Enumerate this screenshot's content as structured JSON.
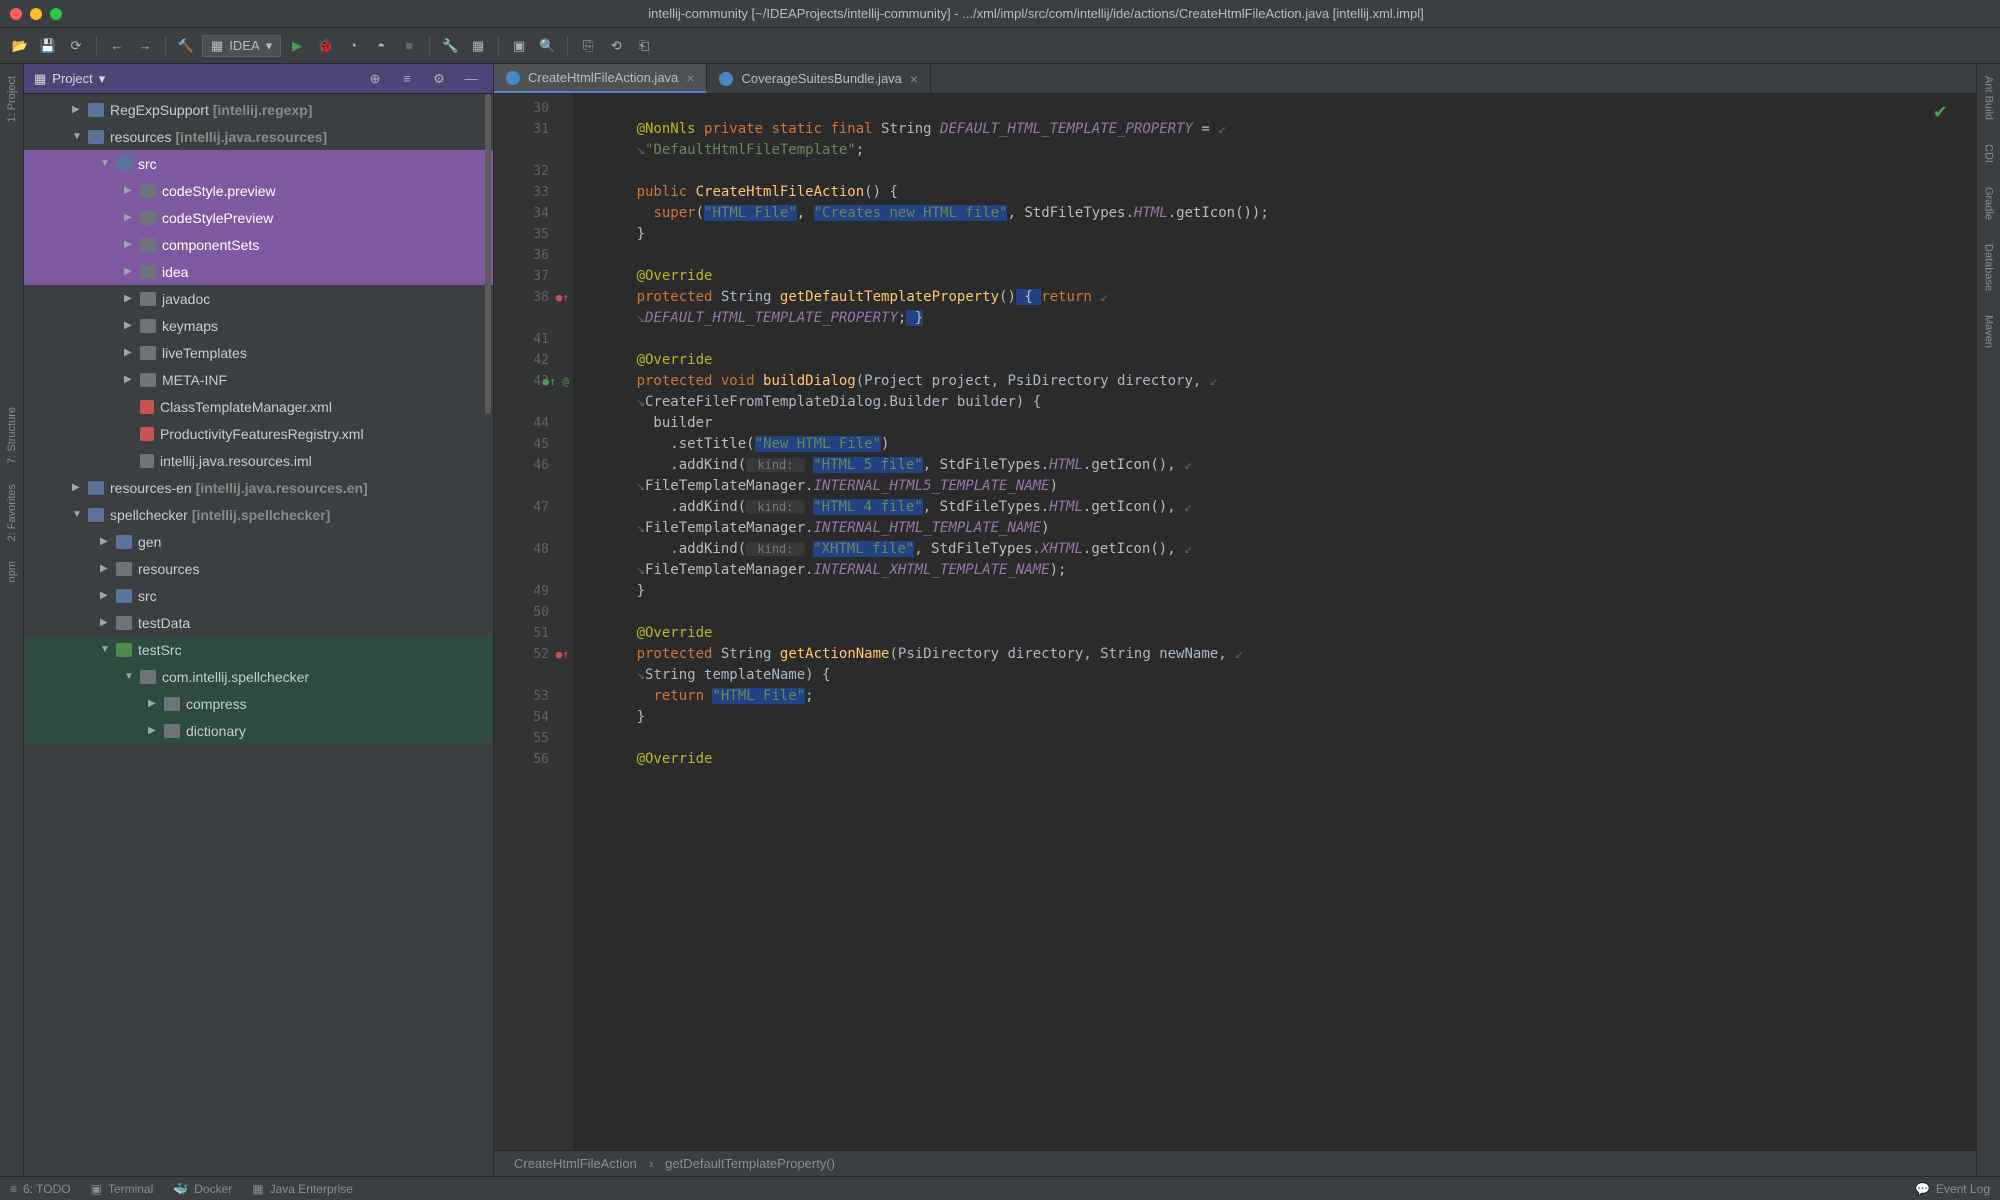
{
  "title": "intellij-community [~/IDEAProjects/intellij-community] - .../xml/impl/src/com/intellij/ide/actions/CreateHtmlFileAction.java [intellij.xml.impl]",
  "runConfig": "IDEA",
  "panel": {
    "title": "Project"
  },
  "tree": [
    {
      "lvl": 1,
      "arrow": "right",
      "icon": "folder-blue",
      "label": "RegExpSupport",
      "extra": "[intellij.regexp]"
    },
    {
      "lvl": 1,
      "arrow": "down",
      "icon": "folder-blue",
      "label": "resources",
      "extra": "[intellij.java.resources]"
    },
    {
      "lvl": 2,
      "arrow": "down",
      "icon": "folder-blue",
      "label": "src",
      "sel": "purple"
    },
    {
      "lvl": 3,
      "arrow": "right",
      "icon": "folder-grey",
      "label": "codeStyle.preview",
      "sel": "purple"
    },
    {
      "lvl": 3,
      "arrow": "right",
      "icon": "folder-grey",
      "label": "codeStylePreview",
      "sel": "purple"
    },
    {
      "lvl": 3,
      "arrow": "right",
      "icon": "folder-grey",
      "label": "componentSets",
      "sel": "purple"
    },
    {
      "lvl": 3,
      "arrow": "right",
      "icon": "folder-grey",
      "label": "idea",
      "sel": "purple"
    },
    {
      "lvl": 3,
      "arrow": "right",
      "icon": "folder-grey",
      "label": "javadoc"
    },
    {
      "lvl": 3,
      "arrow": "right",
      "icon": "folder-grey",
      "label": "keymaps"
    },
    {
      "lvl": 3,
      "arrow": "right",
      "icon": "folder-grey",
      "label": "liveTemplates"
    },
    {
      "lvl": 3,
      "arrow": "right",
      "icon": "folder-grey",
      "label": "META-INF"
    },
    {
      "lvl": 3,
      "arrow": "none",
      "icon": "file-xml",
      "label": "ClassTemplateManager.xml"
    },
    {
      "lvl": 3,
      "arrow": "none",
      "icon": "file-xml",
      "label": "ProductivityFeaturesRegistry.xml"
    },
    {
      "lvl": 3,
      "arrow": "none",
      "icon": "file-iml",
      "label": "intellij.java.resources.iml"
    },
    {
      "lvl": 1,
      "arrow": "right",
      "icon": "folder-blue",
      "label": "resources-en",
      "extra": "[intellij.java.resources.en]"
    },
    {
      "lvl": 1,
      "arrow": "down",
      "icon": "folder-blue",
      "label": "spellchecker",
      "extra": "[intellij.spellchecker]"
    },
    {
      "lvl": 2,
      "arrow": "right",
      "icon": "folder-blue",
      "label": "gen"
    },
    {
      "lvl": 2,
      "arrow": "right",
      "icon": "folder-grey",
      "label": "resources"
    },
    {
      "lvl": 2,
      "arrow": "right",
      "icon": "folder-blue",
      "label": "src"
    },
    {
      "lvl": 2,
      "arrow": "right",
      "icon": "folder-grey",
      "label": "testData"
    },
    {
      "lvl": 2,
      "arrow": "down",
      "icon": "folder-green",
      "label": "testSrc",
      "sel": "green"
    },
    {
      "lvl": 3,
      "arrow": "down",
      "icon": "folder-grey",
      "label": "com.intellij.spellchecker",
      "sel": "green"
    },
    {
      "lvl": 4,
      "arrow": "right",
      "icon": "folder-grey",
      "label": "compress",
      "sel": "green"
    },
    {
      "lvl": 4,
      "arrow": "right",
      "icon": "folder-grey",
      "label": "dictionary",
      "sel": "green"
    }
  ],
  "tabs": [
    {
      "label": "CreateHtmlFileAction.java",
      "active": true
    },
    {
      "label": "CoverageSuitesBundle.java",
      "active": false
    }
  ],
  "leftStrip": [
    "1: Project",
    "7: Structure",
    "2: Favorites",
    "npm"
  ],
  "rightStrip": [
    "Ant Build",
    "CDI",
    "Gradle",
    "Database",
    "Maven"
  ],
  "breadcrumb": [
    "CreateHtmlFileAction",
    "getDefaultTemplateProperty()"
  ],
  "status": [
    "6: TODO",
    "Terminal",
    "Docker",
    "Java Enterprise"
  ],
  "statusRight": "Event Log",
  "code": {
    "lines": [
      {
        "n": 30,
        "seg": []
      },
      {
        "n": 31,
        "seg": [
          {
            "t": "@NonNls ",
            "c": "ann"
          },
          {
            "t": "private static final ",
            "c": "kw"
          },
          {
            "t": "String ",
            "c": "type"
          },
          {
            "t": "DEFAULT_HTML_TEMPLATE_PROPERTY",
            "c": "fld"
          },
          {
            "t": " = ",
            "c": ""
          },
          {
            "t": "↙",
            "c": "wrap-arrow"
          }
        ]
      },
      {
        "n": "",
        "seg": [
          {
            "t": "↘",
            "c": "wrap-arrow"
          },
          {
            "t": "\"DefaultHtmlFileTemplate\"",
            "c": "str"
          },
          {
            "t": ";",
            "c": ""
          }
        ]
      },
      {
        "n": 32,
        "seg": []
      },
      {
        "n": 33,
        "seg": [
          {
            "t": "public ",
            "c": "kw"
          },
          {
            "t": "CreateHtmlFileAction",
            "c": "fn"
          },
          {
            "t": "() {",
            "c": ""
          }
        ]
      },
      {
        "n": 34,
        "seg": [
          {
            "t": "  ",
            "c": ""
          },
          {
            "t": "super",
            "c": "kw"
          },
          {
            "t": "(",
            "c": ""
          },
          {
            "t": "\"HTML File\"",
            "c": "str hl"
          },
          {
            "t": ", ",
            "c": ""
          },
          {
            "t": "\"Creates new HTML file\"",
            "c": "str hl"
          },
          {
            "t": ", StdFileTypes.",
            "c": ""
          },
          {
            "t": "HTML",
            "c": "fld"
          },
          {
            "t": ".getIcon());",
            "c": ""
          }
        ]
      },
      {
        "n": 35,
        "seg": [
          {
            "t": "}",
            "c": ""
          }
        ]
      },
      {
        "n": 36,
        "seg": []
      },
      {
        "n": 37,
        "seg": [
          {
            "t": "@Override",
            "c": "ann"
          }
        ]
      },
      {
        "n": 38,
        "mark": "●↑",
        "markColor": "#c75450",
        "seg": [
          {
            "t": "protected ",
            "c": "kw"
          },
          {
            "t": "String ",
            "c": "type"
          },
          {
            "t": "getDefaultTemplateProperty",
            "c": "fn"
          },
          {
            "t": "()",
            "c": ""
          },
          {
            "t": " { ",
            "c": "hl"
          },
          {
            "t": "return ",
            "c": "kw"
          },
          {
            "t": "↙",
            "c": "wrap-arrow"
          }
        ]
      },
      {
        "n": "",
        "seg": [
          {
            "t": "↘",
            "c": "wrap-arrow"
          },
          {
            "t": "DEFAULT_HTML_TEMPLATE_PROPERTY",
            "c": "fld"
          },
          {
            "t": ";",
            "c": ""
          },
          {
            "t": " }",
            "c": "hl"
          }
        ]
      },
      {
        "n": 41,
        "seg": []
      },
      {
        "n": 42,
        "seg": [
          {
            "t": "@Override",
            "c": "ann"
          }
        ]
      },
      {
        "n": 43,
        "mark": "●↑ @",
        "markColor": "#499c54",
        "seg": [
          {
            "t": "protected void ",
            "c": "kw"
          },
          {
            "t": "buildDialog",
            "c": "fn"
          },
          {
            "t": "(Project project, PsiDirectory directory, ",
            "c": "param"
          },
          {
            "t": "↙",
            "c": "wrap-arrow"
          }
        ]
      },
      {
        "n": "",
        "seg": [
          {
            "t": "↘",
            "c": "wrap-arrow"
          },
          {
            "t": "CreateFileFromTemplateDialog.Builder builder) {",
            "c": "param"
          }
        ]
      },
      {
        "n": 44,
        "seg": [
          {
            "t": "  builder",
            "c": ""
          }
        ]
      },
      {
        "n": 45,
        "seg": [
          {
            "t": "    .setTitle(",
            "c": ""
          },
          {
            "t": "\"New HTML File\"",
            "c": "str hl"
          },
          {
            "t": ")",
            "c": ""
          }
        ]
      },
      {
        "n": 46,
        "seg": [
          {
            "t": "    .addKind(",
            "c": ""
          },
          {
            "t": " kind: ",
            "c": "hint"
          },
          {
            "t": " ",
            "c": ""
          },
          {
            "t": "\"HTML 5 file\"",
            "c": "str hl"
          },
          {
            "t": ", StdFileTypes.",
            "c": ""
          },
          {
            "t": "HTML",
            "c": "fld"
          },
          {
            "t": ".getIcon(), ",
            "c": ""
          },
          {
            "t": "↙",
            "c": "wrap-arrow"
          }
        ]
      },
      {
        "n": "",
        "seg": [
          {
            "t": "↘",
            "c": "wrap-arrow"
          },
          {
            "t": "FileTemplateManager.",
            "c": ""
          },
          {
            "t": "INTERNAL_HTML5_TEMPLATE_NAME",
            "c": "fld"
          },
          {
            "t": ")",
            "c": ""
          }
        ]
      },
      {
        "n": 47,
        "seg": [
          {
            "t": "    .addKind(",
            "c": ""
          },
          {
            "t": " kind: ",
            "c": "hint"
          },
          {
            "t": " ",
            "c": ""
          },
          {
            "t": "\"HTML 4 file\"",
            "c": "str hl"
          },
          {
            "t": ", StdFileTypes.",
            "c": ""
          },
          {
            "t": "HTML",
            "c": "fld"
          },
          {
            "t": ".getIcon(), ",
            "c": ""
          },
          {
            "t": "↙",
            "c": "wrap-arrow"
          }
        ]
      },
      {
        "n": "",
        "seg": [
          {
            "t": "↘",
            "c": "wrap-arrow"
          },
          {
            "t": "FileTemplateManager.",
            "c": ""
          },
          {
            "t": "INTERNAL_HTML_TEMPLATE_NAME",
            "c": "fld"
          },
          {
            "t": ")",
            "c": ""
          }
        ]
      },
      {
        "n": 48,
        "seg": [
          {
            "t": "    .addKind(",
            "c": ""
          },
          {
            "t": " kind: ",
            "c": "hint"
          },
          {
            "t": " ",
            "c": ""
          },
          {
            "t": "\"XHTML file\"",
            "c": "str hl"
          },
          {
            "t": ", StdFileTypes.",
            "c": ""
          },
          {
            "t": "XHTML",
            "c": "fld"
          },
          {
            "t": ".getIcon(), ",
            "c": ""
          },
          {
            "t": "↙",
            "c": "wrap-arrow"
          }
        ]
      },
      {
        "n": "",
        "seg": [
          {
            "t": "↘",
            "c": "wrap-arrow"
          },
          {
            "t": "FileTemplateManager.",
            "c": ""
          },
          {
            "t": "INTERNAL_XHTML_TEMPLATE_NAME",
            "c": "fld"
          },
          {
            "t": ");",
            "c": ""
          }
        ]
      },
      {
        "n": 49,
        "seg": [
          {
            "t": "}",
            "c": ""
          }
        ]
      },
      {
        "n": 50,
        "seg": []
      },
      {
        "n": 51,
        "seg": [
          {
            "t": "@Override",
            "c": "ann"
          }
        ]
      },
      {
        "n": 52,
        "mark": "●↑",
        "markColor": "#c75450",
        "seg": [
          {
            "t": "protected ",
            "c": "kw"
          },
          {
            "t": "String ",
            "c": "type"
          },
          {
            "t": "getActionName",
            "c": "fn"
          },
          {
            "t": "(PsiDirectory directory, String newName, ",
            "c": "param"
          },
          {
            "t": "↙",
            "c": "wrap-arrow"
          }
        ]
      },
      {
        "n": "",
        "seg": [
          {
            "t": "↘",
            "c": "wrap-arrow"
          },
          {
            "t": "String templateName) {",
            "c": "param"
          }
        ]
      },
      {
        "n": 53,
        "seg": [
          {
            "t": "  ",
            "c": ""
          },
          {
            "t": "return ",
            "c": "kw"
          },
          {
            "t": "\"HTML File\"",
            "c": "str hl"
          },
          {
            "t": ";",
            "c": ""
          }
        ]
      },
      {
        "n": 54,
        "seg": [
          {
            "t": "}",
            "c": ""
          }
        ]
      },
      {
        "n": 55,
        "seg": []
      },
      {
        "n": 56,
        "seg": [
          {
            "t": "@Override",
            "c": "ann"
          }
        ]
      }
    ]
  }
}
